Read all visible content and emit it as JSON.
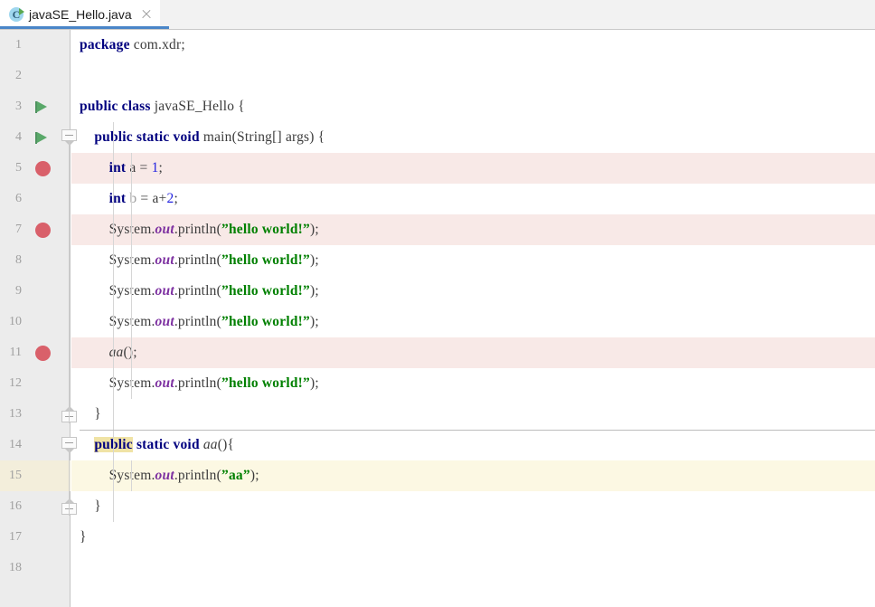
{
  "window": {
    "kind": "java-code-editor"
  },
  "tab": {
    "icon": "java-class-runnable-icon",
    "title": "javaSE_Hello.java",
    "close_label": "close-icon"
  },
  "colors": {
    "tab_underline": "#4a86c8",
    "breakpoint": "#d9606a",
    "run_arrow": "#59a869",
    "breakpoint_row_bg": "#f8e9e7",
    "caret_row_bg": "#fcf8e3",
    "gutter_bg": "#ececec",
    "keyword": "#00007f",
    "string": "#008000",
    "number": "#2424e0",
    "static_field": "#7c2fa0",
    "usage_highlight": "#f0e3a5"
  },
  "editor": {
    "language": "Java",
    "total_lines": 18,
    "gutter_numbers": [
      "1",
      "2",
      "3",
      "4",
      "5",
      "6",
      "7",
      "8",
      "9",
      "10",
      "11",
      "12",
      "13",
      "14",
      "15",
      "16",
      "17",
      "18"
    ],
    "breakpoint_lines": [
      5,
      7,
      11
    ],
    "run_marker_lines": [
      3,
      4
    ],
    "caret_line": 15,
    "fold_open_lines": [
      4,
      14
    ],
    "fold_close_lines": [
      13,
      16
    ],
    "lines": [
      {
        "n": "1",
        "text": "package com.xdr;"
      },
      {
        "n": "2",
        "text": ""
      },
      {
        "n": "3",
        "text": "public class javaSE_Hello {"
      },
      {
        "n": "4",
        "text": "    public static void main(String[] args) {"
      },
      {
        "n": "5",
        "text": "        int a = 1;"
      },
      {
        "n": "6",
        "text": "        int b = a+2;"
      },
      {
        "n": "7",
        "text": "        System.out.println(\"hello world!\");"
      },
      {
        "n": "8",
        "text": "        System.out.println(\"hello world!\");"
      },
      {
        "n": "9",
        "text": "        System.out.println(\"hello world!\");"
      },
      {
        "n": "10",
        "text": "        System.out.println(\"hello world!\");"
      },
      {
        "n": "11",
        "text": "        aa();"
      },
      {
        "n": "12",
        "text": "        System.out.println(\"hello world!\");"
      },
      {
        "n": "13",
        "text": "    }"
      },
      {
        "n": "14",
        "text": "    public static void aa(){"
      },
      {
        "n": "15",
        "text": "        System.out.println(\"aa\");"
      },
      {
        "n": "16",
        "text": "    }"
      },
      {
        "n": "17",
        "text": "}"
      },
      {
        "n": "18",
        "text": ""
      }
    ]
  }
}
